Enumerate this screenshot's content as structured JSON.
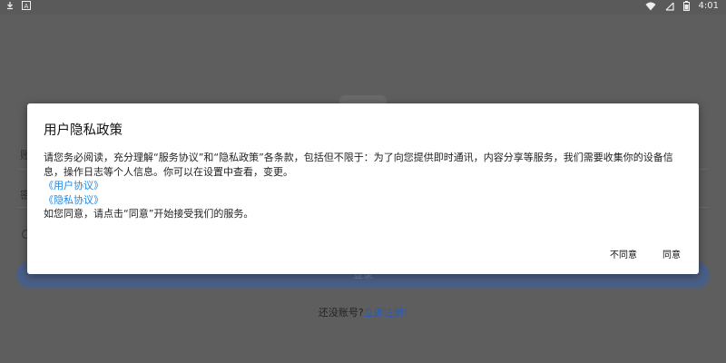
{
  "status_bar": {
    "time": "4:01",
    "left_icons": [
      "download-icon",
      "font-icon"
    ],
    "right_icons": [
      "wifi-icon",
      "no-sim-icon",
      "battery-icon"
    ]
  },
  "background": {
    "register_prompt": "还没账号?",
    "register_link": "立即注册!",
    "login_button": "登录",
    "field_char_1": "账",
    "field_char_2": "密"
  },
  "dialog": {
    "title": "用户隐私政策",
    "body_line_1": "请您务必阅读，充分理解“服务协议”和“隐私政策”各条款，包括但不限于：为了向您提供即时通讯，内容分享等服务，我们需要收集你的设备信息，操作日志等个人信息。你可以在设置中查看，变更。",
    "user_agreement_link": "《用户协议》",
    "privacy_agreement_link": "《隐私协议》",
    "body_line_2": "如您同意，请点击“同意”开始接受我们的服务。",
    "disagree_label": "不同意",
    "agree_label": "同意"
  },
  "colors": {
    "link": "#1e88e5",
    "overlay": "#5e5e5e",
    "login_button": "#4a5f86"
  }
}
